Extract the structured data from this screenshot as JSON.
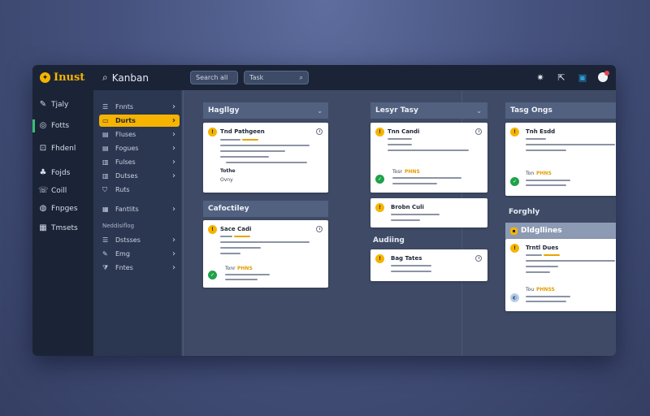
{
  "app": {
    "brand": "Inust",
    "search_label": "Kanban",
    "search_box_1": "Search all",
    "search_box_2": "Task"
  },
  "topbar_icons": [
    "sparkle-icon",
    "export-icon",
    "calendar-icon",
    "notifications-avatar-icon"
  ],
  "nav_primary": [
    {
      "label": "Tjaly",
      "icon": "dashboard-icon"
    },
    {
      "label": "Fotts",
      "icon": "chat-icon",
      "active": true
    },
    {
      "label": "Fhdenl",
      "icon": "files-icon"
    },
    {
      "label": "Fojds",
      "icon": "people-icon"
    },
    {
      "label": "Coill",
      "icon": "call-icon"
    },
    {
      "label": "Fnpges",
      "icon": "globe-icon"
    },
    {
      "label": "Tmsets",
      "icon": "grid-icon"
    }
  ],
  "nav_secondary": [
    {
      "label": "Fnnts",
      "icon": "list-icon"
    },
    {
      "label": "Durts",
      "icon": "folder-icon",
      "active": true
    },
    {
      "label": "Fluses",
      "icon": "board-icon"
    },
    {
      "label": "Fogues",
      "icon": "board-icon"
    },
    {
      "label": "Fulses",
      "icon": "doc-icon"
    },
    {
      "label": "Dutses",
      "icon": "doc-icon"
    },
    {
      "label": "Ruts",
      "icon": "shield-icon"
    },
    {
      "label": "Fantlits",
      "icon": "grid-icon"
    }
  ],
  "nav_secondary_heading": "Neddisiflog",
  "nav_secondary_bottom": [
    {
      "label": "Dstsses",
      "icon": "list-icon"
    },
    {
      "label": "Emg",
      "icon": "pen-icon"
    },
    {
      "label": "Fntes",
      "icon": "filter-icon"
    }
  ],
  "colors": {
    "accent": "#f6b400",
    "sidebar": "#1b2436",
    "board": "#3f4b66",
    "success": "#1fa24b",
    "active_indicator": "#3bbf72"
  },
  "columns": [
    {
      "header": "Hagllgy",
      "card_a": {
        "title": "Tnd Pathgeen",
        "sub_label": "Tothe",
        "sub_value": "Ovny"
      },
      "section": "Cafoctiley",
      "card_b": {
        "title": "Sace Cadi",
        "footer_tag": "Tonr",
        "footer_value": "PHNS"
      }
    },
    {
      "header": "Lesyr Tasy",
      "card_a": {
        "title": "Tnn Candi",
        "footer_tag": "Tosr",
        "footer_value": "PHNS"
      },
      "card_b": {
        "title": "Brobn Culi"
      },
      "section": "Audiing",
      "card_c": {
        "title": "Bag Tates"
      }
    },
    {
      "header": "Tasg Ongs",
      "card_a": {
        "title": "Tnh Esdd",
        "footer_tag": "Ton",
        "footer_value": "PHNS"
      },
      "section": "Forghly",
      "highlight_header": "Dldgllines",
      "card_b": {
        "title": "Trntl Dues",
        "footer_tag": "Tou",
        "footer_value": "PHNSS"
      }
    }
  ]
}
